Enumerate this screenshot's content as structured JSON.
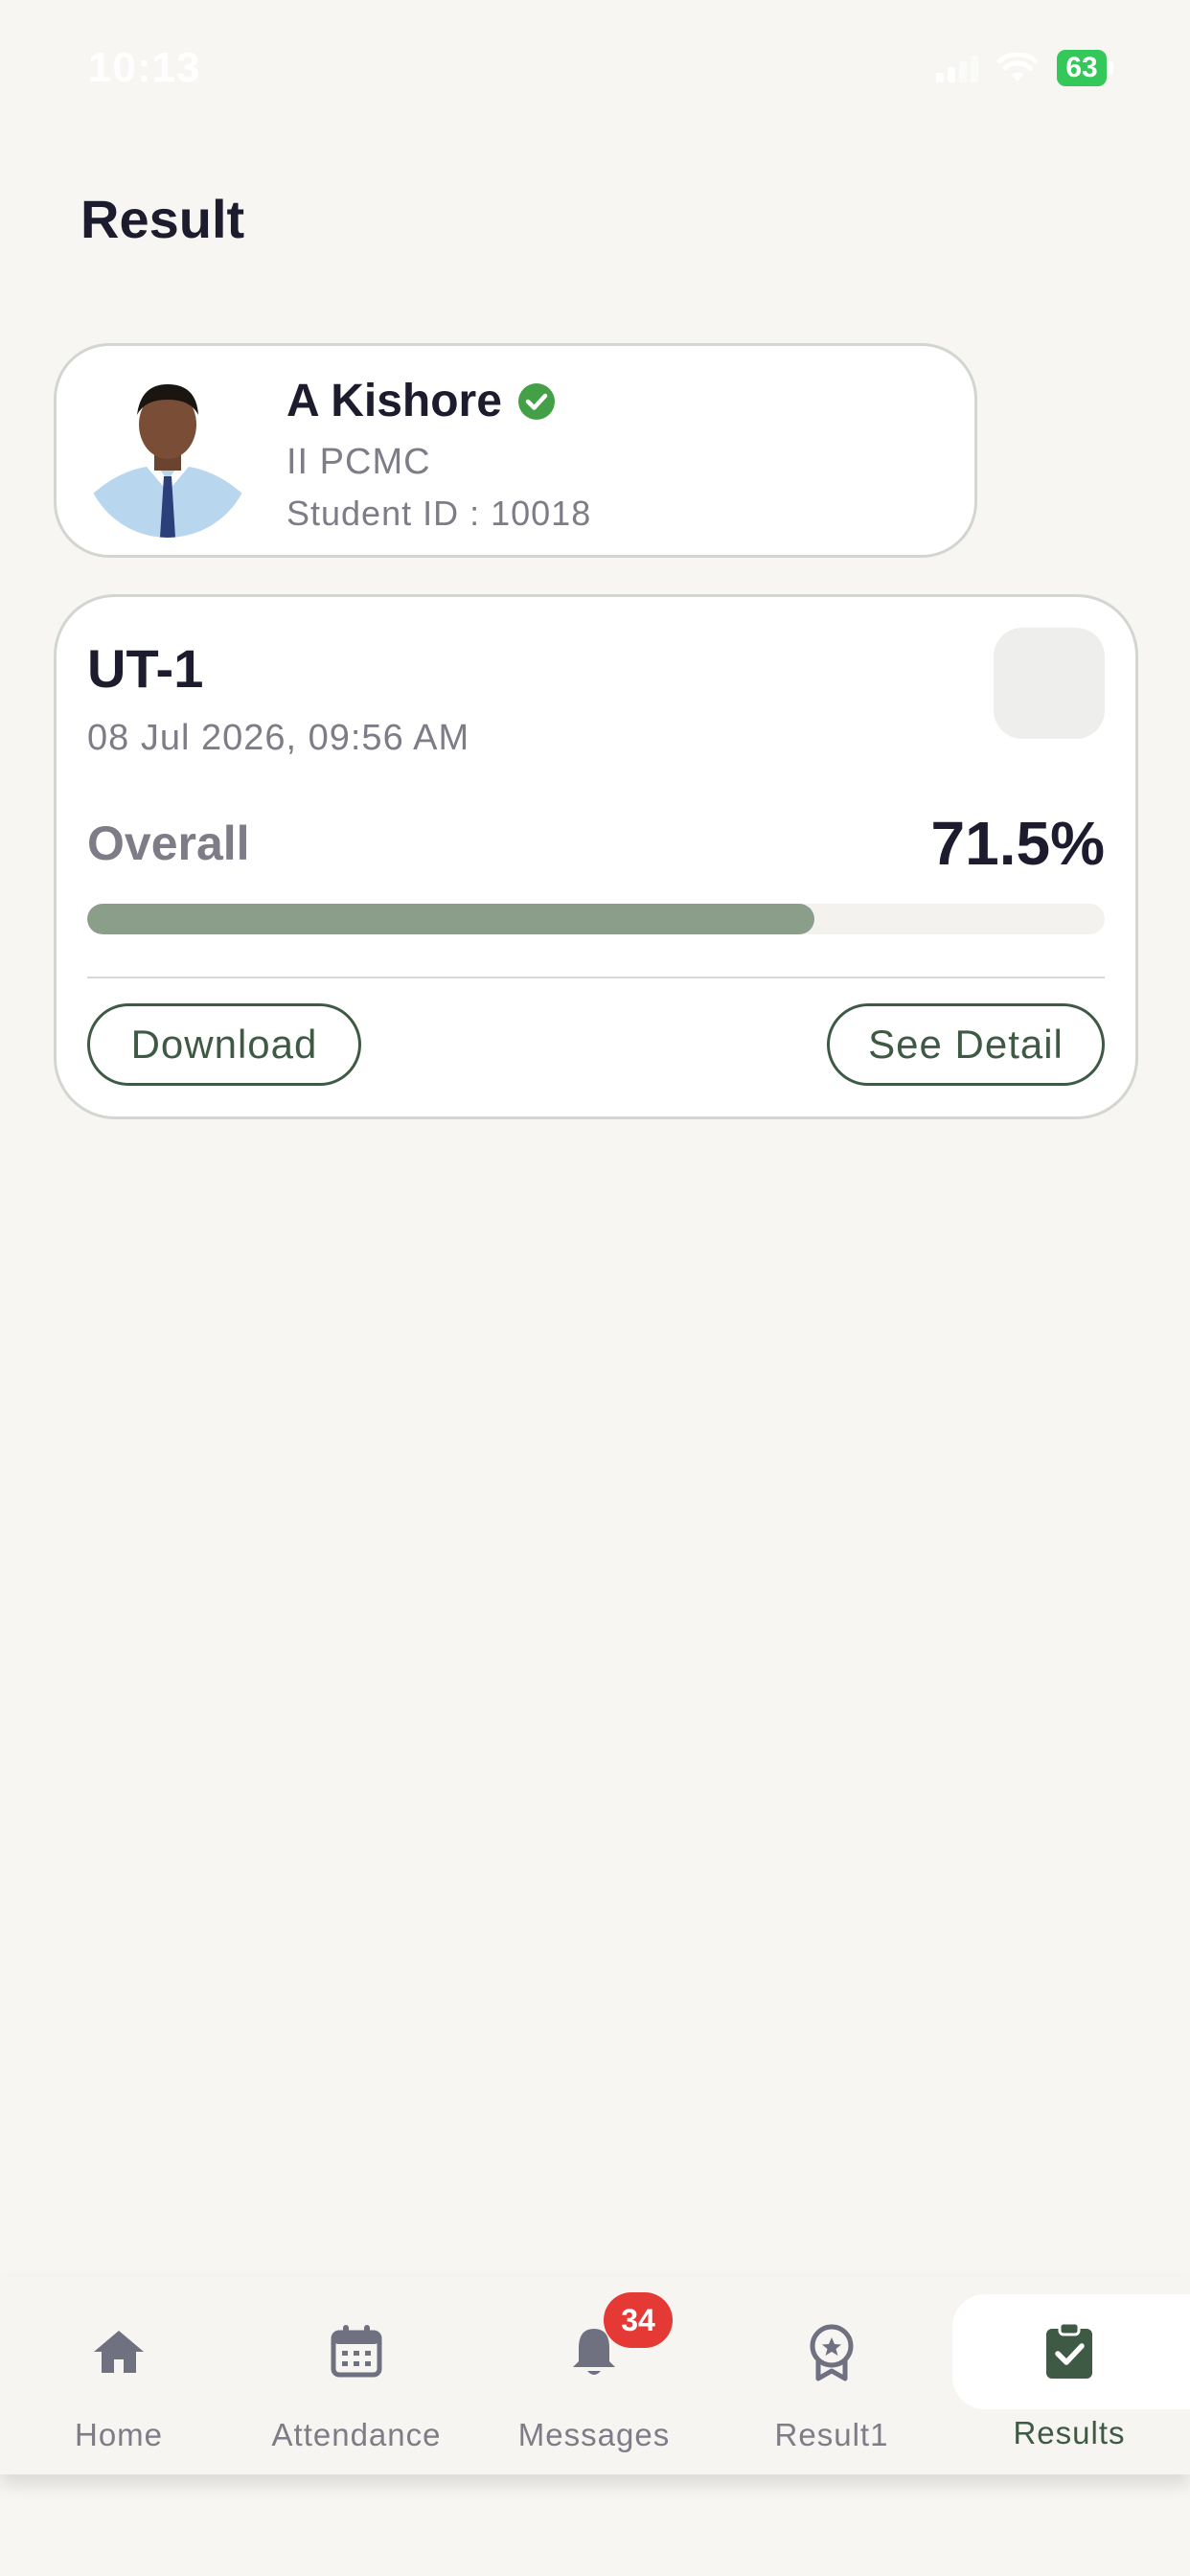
{
  "status_bar": {
    "time": "10:13",
    "battery": "63",
    "icons": [
      "signal-icon",
      "wifi-icon",
      "battery-icon"
    ]
  },
  "page": {
    "title": "Result"
  },
  "profile": {
    "name": "A Kishore",
    "class": "II PCMC",
    "student_id": "Student ID : 10018",
    "verified": true,
    "avatar": "student-photo"
  },
  "result": {
    "exam": "UT-1",
    "date": "08 Jul 2026, 09:56 AM",
    "overall_label": "Overall",
    "overall_value": "71.5%",
    "progress_fraction": 0.715,
    "download_label": "Download",
    "detail_label": "See Detail"
  },
  "tabs": [
    {
      "label": "Home",
      "icon": "home-icon"
    },
    {
      "label": "Attendance",
      "icon": "calendar-icon"
    },
    {
      "label": "Messages",
      "icon": "bell-icon",
      "badge": "34"
    },
    {
      "label": "Result1",
      "icon": "award-icon"
    },
    {
      "label": "Results",
      "icon": "clipboard-check-icon",
      "active": true
    }
  ],
  "colors": {
    "background": "#f7f6f2",
    "accent": "#3f5a44",
    "progress": "#8b9e8a",
    "verified": "#43a047",
    "badge": "#e53935",
    "text_primary": "#1d1c2e",
    "text_secondary": "#7d7c87"
  }
}
